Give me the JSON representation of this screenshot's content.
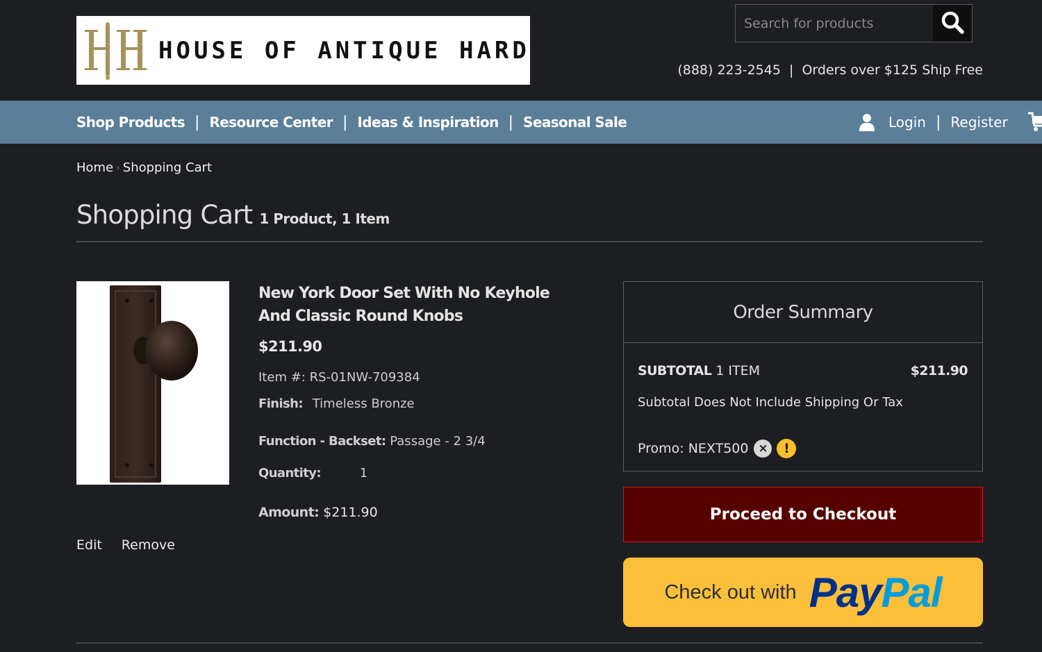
{
  "header": {
    "logo_text": "HOUSE OF ANTIQUE HARDWARE",
    "search_placeholder": "Search for products",
    "phone": "(888) 223-2545",
    "separator": "|",
    "shipping": "Orders over $125 Ship Free"
  },
  "nav": {
    "items": [
      {
        "label": "Shop Products"
      },
      {
        "label": "Resource Center"
      },
      {
        "label": "Ideas & Inspiration"
      },
      {
        "label": "Seasonal Sale"
      }
    ],
    "separator": "|",
    "login": "Login",
    "register": "Register"
  },
  "breadcrumb": {
    "items": [
      "Home",
      "Shopping Cart"
    ],
    "separator": "›"
  },
  "page": {
    "title": "Shopping Cart",
    "count": "1 Product, 1 Item"
  },
  "product": {
    "name": "New York Door Set With No Keyhole And Classic Round Knobs",
    "price": "$211.90",
    "item_label": "Item #:",
    "item_number": "RS-01NW-709384",
    "finish_label": "Finish:",
    "finish_value": "Timeless Bronze",
    "function_label": "Function - Backset:",
    "function_value": "Passage - 2 3/4",
    "quantity_label": "Quantity:",
    "quantity_value": "1",
    "amount_label": "Amount:",
    "amount_value": "$211.90",
    "edit": "Edit",
    "remove": "Remove"
  },
  "summary": {
    "title": "Order Summary",
    "subtotal_label": "SUBTOTAL",
    "subtotal_items": "1 ITEM",
    "subtotal_value": "$211.90",
    "note": "Subtotal Does Not Include Shipping Or Tax",
    "promo_label": "Promo:",
    "promo_code": "NEXT500",
    "promo_remove": "×",
    "promo_warning": "!"
  },
  "buttons": {
    "checkout": "Proceed to Checkout",
    "paypal_prefix": "Check out with",
    "paypal_pay": "Pay",
    "paypal_pal": "Pal"
  },
  "colors": {
    "background": "#1d1e22",
    "nav": "#5b7e99",
    "checkout": "#560000",
    "paypal": "#fcbf3a"
  }
}
